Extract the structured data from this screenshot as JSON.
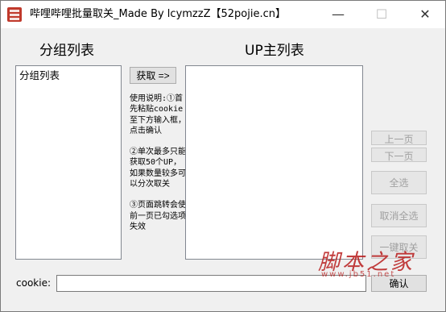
{
  "window": {
    "title": "哔哩哔哩批量取关_Made By lcymzzZ【52pojie.cn】",
    "minimize_glyph": "—",
    "maximize_glyph": "☐",
    "close_glyph": "✕"
  },
  "left_panel": {
    "heading": "分组列表",
    "items": [
      "分组列表"
    ]
  },
  "right_panel": {
    "heading": "UP主列表",
    "items": []
  },
  "fetch_button": "获取 =>",
  "instructions": [
    "使用说明:①首先粘贴cookie至下方输入框，点击确认",
    "②单次最多只能获取50个UP，如果数量较多可以分次取关",
    "③页面跳转会使前一页已勾选项失效"
  ],
  "buttons": {
    "prev_page": "上一页",
    "next_page": "下一页",
    "select_all": "全选",
    "deselect_all": "取消全选",
    "unfollow_all": "一键取关",
    "confirm": "确认"
  },
  "cookie": {
    "label": "cookie:",
    "value": ""
  },
  "watermark": {
    "text": "脚本之家",
    "sub": "www.jb51.net"
  },
  "colors": {
    "accent": "#c0392b",
    "watermark": "#b81c1c"
  },
  "icons": {
    "app": "bilibili-app-icon"
  }
}
